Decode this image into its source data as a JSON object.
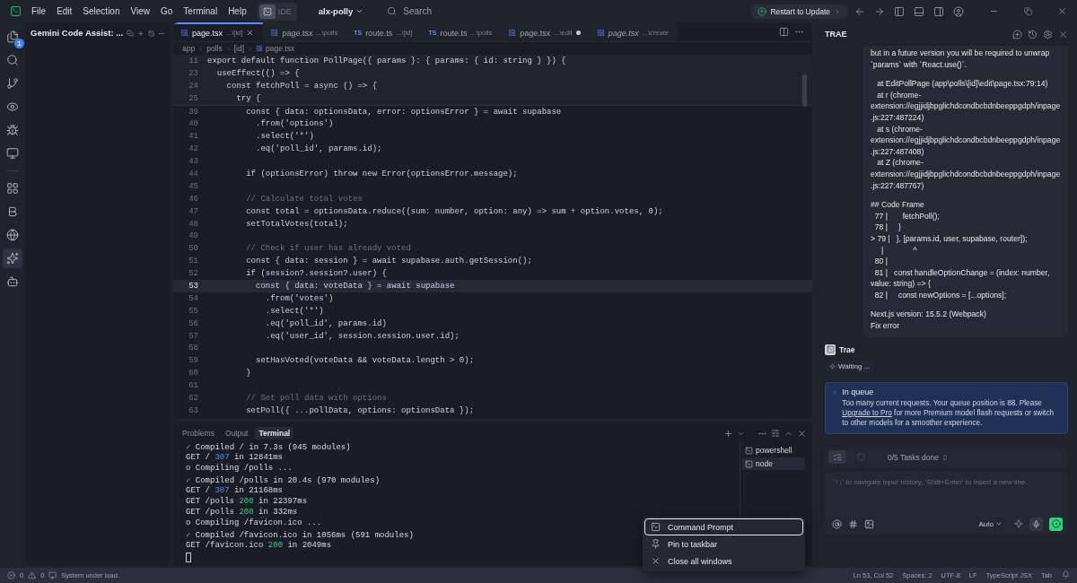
{
  "menu": [
    "File",
    "Edit",
    "Selection",
    "View",
    "Go",
    "Terminal",
    "Help"
  ],
  "mode_toggle": {
    "label": "IDE"
  },
  "project": "alx-polly",
  "search": {
    "placeholder": "Search"
  },
  "update_button": "Restart to Update",
  "activity_bar": {
    "top": [
      {
        "kind": "files",
        "badge": "1",
        "selected": false
      },
      {
        "kind": "search",
        "selected": false
      },
      {
        "kind": "branch",
        "selected": false
      },
      {
        "kind": "eye",
        "selected": false
      },
      {
        "kind": "bug",
        "selected": false
      },
      {
        "kind": "monitor",
        "selected": false
      }
    ],
    "bottom": [
      {
        "kind": "grid",
        "selected": false
      },
      {
        "kind": "logo",
        "selected": false
      },
      {
        "kind": "globe",
        "selected": false
      },
      {
        "kind": "sparkle",
        "selected": true
      },
      {
        "kind": "bot",
        "selected": false
      }
    ]
  },
  "side_panel": {
    "title": "Gemini Code Assist: ..."
  },
  "tabs": [
    {
      "name": "page.tsx",
      "path": "...\\[id]",
      "selected": true,
      "modified": false,
      "preview": false
    },
    {
      "name": "page.tsx",
      "path": "...\\polls",
      "selected": false,
      "modified": false,
      "preview": false
    },
    {
      "badge": "TS",
      "name": "route.ts",
      "path": "...\\[id]",
      "selected": false,
      "modified": false,
      "preview": false
    },
    {
      "badge": "TS",
      "name": "route.ts",
      "path": "...\\polls",
      "selected": false,
      "modified": false,
      "preview": false
    },
    {
      "name": "page.tsx",
      "path": "...\\edit",
      "selected": false,
      "modified": true,
      "preview": false
    },
    {
      "name": "page.tsx",
      "path": "...\\create",
      "selected": false,
      "modified": false,
      "preview": true
    }
  ],
  "breadcrumb": [
    "app",
    "polls",
    "[id]",
    "page.tsx"
  ],
  "sticky_scroll": [
    {
      "num": "11",
      "text": "export default function PollPage({ params }: { params: { id: string } }) {"
    },
    {
      "num": "23",
      "text": "  useEffect(() => {"
    },
    {
      "num": "24",
      "text": "    const fetchPoll = async () => {"
    },
    {
      "num": "25",
      "text": "      try {"
    }
  ],
  "code": [
    {
      "num": "39",
      "text": "        const { data: optionsData, error: optionsError } = await supabase",
      "kind": "code",
      "current": false
    },
    {
      "num": "40",
      "text": "          .from('options')",
      "kind": "code",
      "current": false
    },
    {
      "num": "41",
      "text": "          .select('*')",
      "kind": "code",
      "current": false
    },
    {
      "num": "42",
      "text": "          .eq('poll_id', params.id);",
      "kind": "code",
      "current": false
    },
    {
      "num": "43",
      "current": false
    },
    {
      "num": "44",
      "text": "        if (optionsError) throw new Error(optionsError.message);",
      "kind": "code",
      "current": false
    },
    {
      "num": "45",
      "current": false
    },
    {
      "num": "46",
      "text": "        // Calculate total votes",
      "kind": "comment",
      "current": false
    },
    {
      "num": "47",
      "text": "        const total = optionsData.reduce((sum: number, option: any) => sum + option.votes, 0);",
      "kind": "code",
      "current": false
    },
    {
      "num": "48",
      "text": "        setTotalVotes(total);",
      "kind": "code",
      "current": false
    },
    {
      "num": "49",
      "current": false
    },
    {
      "num": "50",
      "text": "        // Check if user has already voted",
      "kind": "comment",
      "current": false
    },
    {
      "num": "51",
      "text": "        const { data: session } = await supabase.auth.getSession();",
      "kind": "code",
      "current": false
    },
    {
      "num": "52",
      "text": "        if (session?.session?.user) {",
      "kind": "code",
      "current": false
    },
    {
      "num": "53",
      "text": "          const { data: voteData } = await supabase",
      "kind": "code",
      "current": true
    },
    {
      "num": "54",
      "text": "            .from('votes')",
      "kind": "code",
      "current": false
    },
    {
      "num": "55",
      "text": "            .select('*')",
      "kind": "code",
      "current": false
    },
    {
      "num": "56",
      "text": "            .eq('poll_id', params.id)",
      "kind": "code",
      "current": false
    },
    {
      "num": "57",
      "text": "            .eq('user_id', session.session.user.id);",
      "kind": "code",
      "current": false
    },
    {
      "num": "58",
      "current": false
    },
    {
      "num": "59",
      "text": "          setHasVoted(voteData && voteData.length > 0);",
      "kind": "code",
      "current": false
    },
    {
      "num": "60",
      "text": "        }",
      "kind": "code",
      "current": false
    },
    {
      "num": "61",
      "current": false
    },
    {
      "num": "62",
      "text": "        // Set poll data with options",
      "kind": "comment",
      "current": false
    },
    {
      "num": "63",
      "text": "        setPoll({ ...pollData, options: optionsData });",
      "kind": "code",
      "current": false
    }
  ],
  "panel_tabs": [
    {
      "label": "Problems",
      "selected": false
    },
    {
      "label": "Output",
      "selected": false
    },
    {
      "label": "Terminal",
      "selected": true
    }
  ],
  "terminal_lines": [
    {
      "parts": [
        {
          "text": "✓",
          "kind": "ok"
        },
        {
          "text": " Compiled / in 7.3s (945 modules)",
          "kind": "plain"
        }
      ]
    },
    {
      "parts": [
        {
          "text": "GET / ",
          "kind": "plain"
        },
        {
          "text": "307",
          "kind": "redirect"
        },
        {
          "text": " in 12841ms",
          "kind": "plain"
        }
      ]
    },
    {
      "parts": [
        {
          "text": "o Compiling /polls ...",
          "kind": "plain"
        }
      ]
    },
    {
      "parts": [
        {
          "text": "✓",
          "kind": "ok"
        },
        {
          "text": " Compiled /polls in 20.4s (970 modules)",
          "kind": "plain"
        }
      ]
    },
    {
      "parts": [
        {
          "text": "GET / ",
          "kind": "plain"
        },
        {
          "text": "307",
          "kind": "redirect"
        },
        {
          "text": " in 21168ms",
          "kind": "plain"
        }
      ]
    },
    {
      "parts": [
        {
          "text": "GET /polls ",
          "kind": "plain"
        },
        {
          "text": "200",
          "kind": "ok"
        },
        {
          "text": " in 22397ms",
          "kind": "plain"
        }
      ]
    },
    {
      "parts": [
        {
          "text": "GET /polls ",
          "kind": "plain"
        },
        {
          "text": "200",
          "kind": "ok"
        },
        {
          "text": " in 332ms",
          "kind": "plain"
        }
      ]
    },
    {
      "parts": [
        {
          "text": "o Compiling /favicon.ico ...",
          "kind": "plain"
        }
      ]
    },
    {
      "parts": [
        {
          "text": "✓",
          "kind": "ok"
        },
        {
          "text": " Compiled /favicon.ico in 1056ms (591 modules)",
          "kind": "plain"
        }
      ]
    },
    {
      "parts": [
        {
          "text": "GET /favicon.ico ",
          "kind": "plain"
        },
        {
          "text": "200",
          "kind": "ok"
        },
        {
          "text": " in 2049ms",
          "kind": "plain"
        }
      ]
    }
  ],
  "terminals": [
    {
      "name": "powershell",
      "selected": false
    },
    {
      "name": "node",
      "selected": true
    }
  ],
  "context_menu": [
    {
      "label": "Command Prompt",
      "kind": "terminal",
      "focused": true
    },
    {
      "label": "Pin to taskbar",
      "kind": "pin",
      "focused": false
    },
    {
      "label": "Close all windows",
      "kind": "close",
      "focused": false
    }
  ],
  "chat": {
    "title": "TRAE",
    "message": [
      [
        "but in a future version you will be required to unwrap `params` with `React.use()`."
      ],
      [
        "   at EditPollPage (app\\polls\\[id]\\edit\\page.tsx:79:14)",
        "   at r (chrome-extension://egjjidjbpglichdcondbcbdnbeeppgdph/inpage.js:227:487224)",
        "   at s (chrome-extension://egjjidjbpglichdcondbcbdnbeeppgdph/inpage.js:227:487408)",
        "   at Z (chrome-extension://egjjidjbpglichdcondbcbdnbeeppgdph/inpage.js:227:487767)"
      ],
      [
        "## Code Frame",
        "  77 |       fetchPoll();",
        "  78 |     }",
        "> 79 |   }, [params.id, user, supabase, router]);",
        "     |              ^",
        "  80 |",
        "  81 |   const handleOptionChange = (index: number, value: string) => {",
        "  82 |     const newOptions = [...options];"
      ],
      [
        "Next.js version: 15.5.2 (Webpack)",
        "Fix error"
      ]
    ],
    "agent": "Trae",
    "status": "Waiting ...",
    "notice": {
      "title": "In queue",
      "before": "Too many current requests. Your queue position is 88. Please ",
      "link": "Upgrade to Pro",
      "after": " for more Premium model flash requests or switch to other models for a smoother experience."
    },
    "tasks": "0/5 Tasks done",
    "input": {
      "placeholder": "'↑↓' to navigate input history, 'Shift+Enter' to insert a new line."
    },
    "model": "Auto"
  },
  "status_bar": {
    "errors": "0",
    "warnings": "0",
    "message": "System under load.",
    "items": [
      "Ln 53, Col 52",
      "Spaces: 2",
      "UTF-8",
      "LF",
      "TypeScript JSX",
      "Tab"
    ]
  }
}
